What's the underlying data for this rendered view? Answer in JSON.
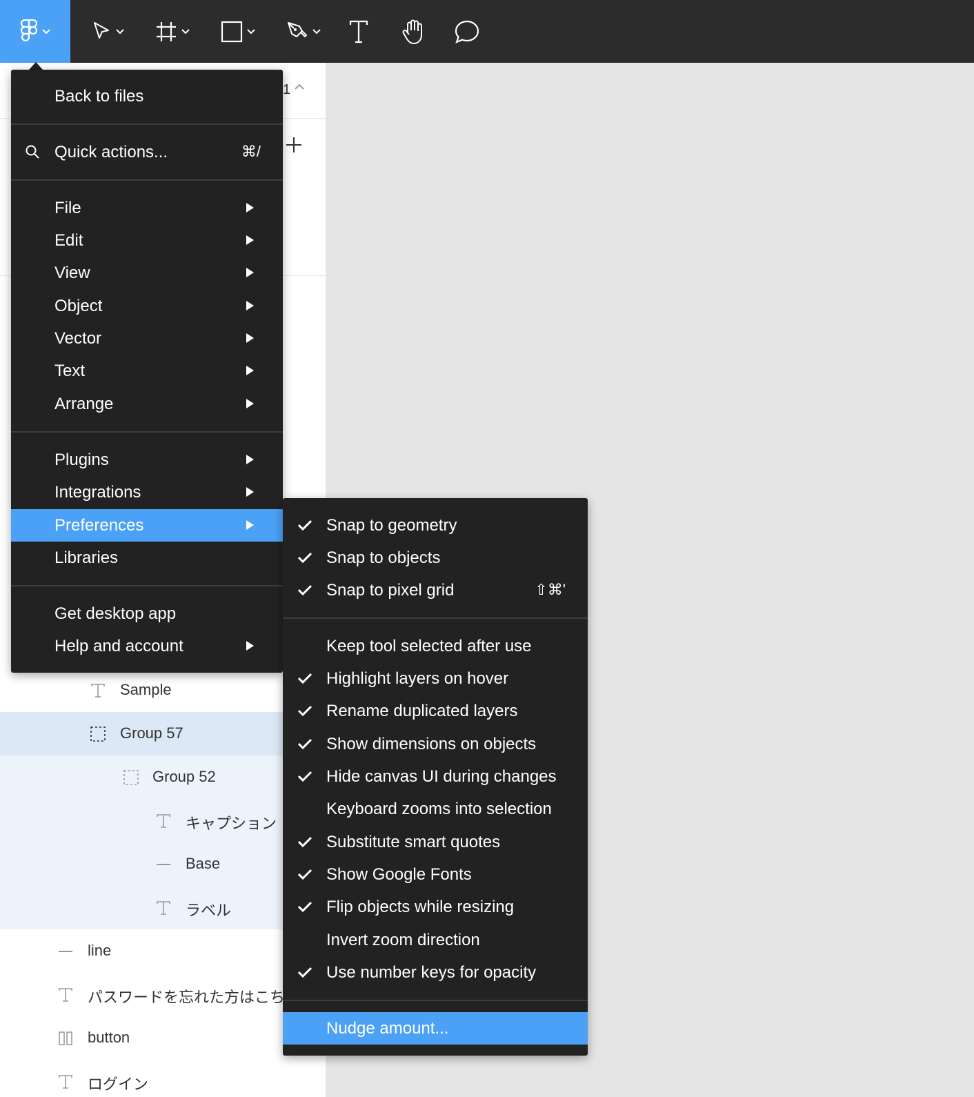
{
  "toolbar": {
    "tools": [
      {
        "name": "main-menu-button",
        "icon": "figma-logo-icon",
        "active": true
      },
      {
        "name": "move-tool",
        "icon": "pointer-icon"
      },
      {
        "name": "frame-tool",
        "icon": "frame-icon"
      },
      {
        "name": "shape-tool",
        "icon": "rectangle-icon"
      },
      {
        "name": "pen-tool",
        "icon": "pen-icon"
      },
      {
        "name": "text-tool",
        "icon": "text-icon"
      },
      {
        "name": "hand-tool",
        "icon": "hand-icon"
      },
      {
        "name": "comment-tool",
        "icon": "comment-icon"
      }
    ],
    "accent_color": "#4ba1f5",
    "background_color": "#2c2c2c"
  },
  "pages": {
    "count_label": "1"
  },
  "layers": [
    {
      "label": "Sample",
      "icon": "text-icon"
    },
    {
      "label": "Group 57",
      "icon": "group-icon",
      "selected": true
    },
    {
      "label": "Group 52",
      "icon": "group-icon"
    },
    {
      "label": "キャプション",
      "icon": "text-icon"
    },
    {
      "label": "Base",
      "icon": "line-icon"
    },
    {
      "label": "ラベル",
      "icon": "text-icon"
    },
    {
      "label": "line",
      "icon": "line-icon"
    },
    {
      "label": "パスワードを忘れた方はこち",
      "icon": "text-icon"
    },
    {
      "label": "button",
      "icon": "component-icon"
    },
    {
      "label": "ログイン",
      "icon": "text-icon"
    }
  ],
  "main_menu": {
    "back_to_files": "Back to files",
    "quick_actions": {
      "label": "Quick actions...",
      "shortcut": "⌘/"
    },
    "items": [
      {
        "label": "File",
        "submenu": true
      },
      {
        "label": "Edit",
        "submenu": true
      },
      {
        "label": "View",
        "submenu": true
      },
      {
        "label": "Object",
        "submenu": true
      },
      {
        "label": "Vector",
        "submenu": true
      },
      {
        "label": "Text",
        "submenu": true
      },
      {
        "label": "Arrange",
        "submenu": true
      },
      {
        "label": "Plugins",
        "submenu": true
      },
      {
        "label": "Integrations",
        "submenu": true
      },
      {
        "label": "Preferences",
        "submenu": true,
        "highlighted": true
      },
      {
        "label": "Libraries",
        "submenu": false
      },
      {
        "label": "Get desktop app",
        "submenu": false
      },
      {
        "label": "Help and account",
        "submenu": true
      }
    ]
  },
  "preferences_menu": {
    "items": [
      {
        "label": "Snap to geometry",
        "checked": true
      },
      {
        "label": "Snap to objects",
        "checked": true
      },
      {
        "label": "Snap to pixel grid",
        "checked": true,
        "shortcut": "⇧⌘'"
      },
      {
        "label": "Keep tool selected after use",
        "checked": false
      },
      {
        "label": "Highlight layers on hover",
        "checked": true
      },
      {
        "label": "Rename duplicated layers",
        "checked": true
      },
      {
        "label": "Show dimensions on objects",
        "checked": true
      },
      {
        "label": "Hide canvas UI during changes",
        "checked": true
      },
      {
        "label": "Keyboard zooms into selection",
        "checked": false
      },
      {
        "label": "Substitute smart quotes",
        "checked": true
      },
      {
        "label": "Show Google Fonts",
        "checked": true
      },
      {
        "label": "Flip objects while resizing",
        "checked": true
      },
      {
        "label": "Invert zoom direction",
        "checked": false
      },
      {
        "label": "Use number keys for opacity",
        "checked": true
      },
      {
        "label": "Nudge amount...",
        "checked": false,
        "highlighted": true
      }
    ]
  }
}
